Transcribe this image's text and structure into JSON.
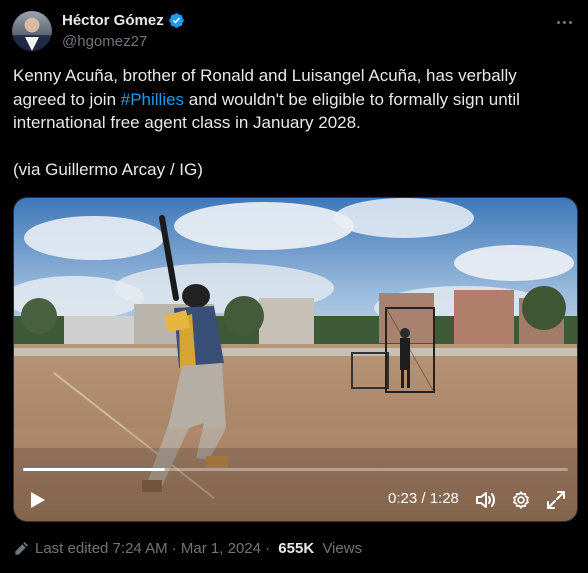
{
  "author": {
    "display_name": "Héctor Gómez",
    "handle": "@hgomez27",
    "verified": true
  },
  "tweet": {
    "text_before": "Kenny Acuña, brother of Ronald and Luisangel Acuña, has verbally agreed to join ",
    "hashtag": "#Phillies",
    "text_after": " and wouldn't be eligible to formally sign until international free agent class in January 2028.",
    "via": "(via Guillermo Arcay / IG)"
  },
  "video": {
    "current_time": "0:23",
    "duration": "1:28",
    "time_display": "0:23 / 1:28",
    "progress_fraction": 0.261
  },
  "footer": {
    "edited_label": "Last edited 7:24 AM · Mar 1, 2024 · ",
    "views_count": "655K",
    "views_label": " Views"
  },
  "icons": {
    "verified": "verified-badge-icon",
    "more": "more-options-icon",
    "play": "play-icon",
    "volume": "volume-icon",
    "settings": "settings-gear-icon",
    "fullscreen": "fullscreen-icon",
    "edit": "pencil-edit-icon"
  },
  "colors": {
    "background": "#000000",
    "text": "#e7e9ea",
    "muted": "#71767b",
    "accent": "#1d9bf0"
  }
}
